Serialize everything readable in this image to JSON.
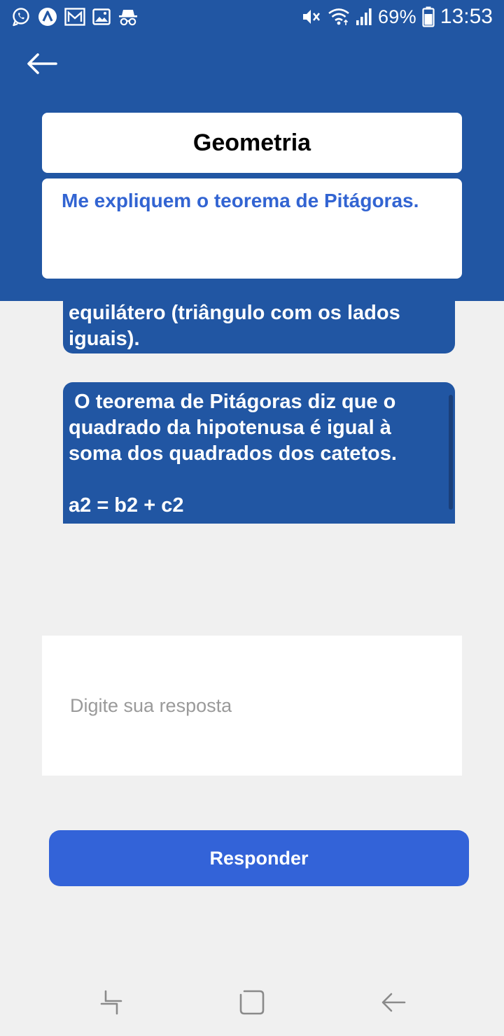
{
  "status_bar": {
    "battery": "69%",
    "time": "13:53",
    "left_icons": [
      "whatsapp-icon",
      "app-a-icon",
      "mail-icon",
      "gallery-icon",
      "incognito-icon"
    ],
    "right_icons": [
      "mute-icon",
      "wifi-icon",
      "signal-icon",
      "battery-icon"
    ]
  },
  "header": {
    "back_icon": "arrow-left-icon",
    "subject_title": "Geometria",
    "question": "Me expliquem o teorema de Pitágoras."
  },
  "answers": [
    {
      "text": "equilátero (triângulo com os lados iguais)."
    },
    {
      "text": " O teorema de Pitágoras diz que o quadrado da hipotenusa é igual à soma dos quadrados dos catetos.\n\na2 = b2 + c2"
    }
  ],
  "response": {
    "placeholder": "Digite sua resposta",
    "value": ""
  },
  "submit": {
    "label": "Responder"
  },
  "nav_bar": {
    "icons": [
      "recent-apps-icon",
      "home-icon",
      "back-icon"
    ]
  },
  "colors": {
    "header_bg": "#2156a3",
    "accent": "#3363d8",
    "question_text": "#3264d2",
    "page_bg": "#f0f0f0"
  }
}
